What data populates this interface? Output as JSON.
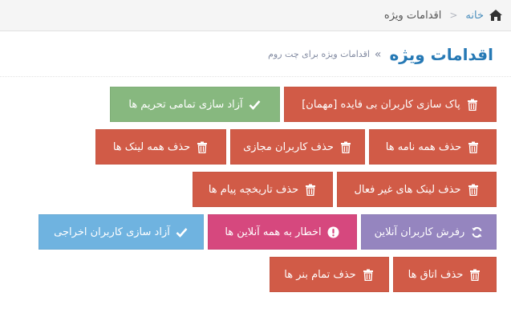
{
  "breadcrumb": {
    "home_label": "خانه",
    "separator": "<",
    "current": "اقدامات ویژه"
  },
  "header": {
    "title": "اقدامات ویژه",
    "arrow": "»",
    "subtitle": "اقدامات ویژه برای چت روم"
  },
  "colors": {
    "red": "#d15b47",
    "green": "#87b87f",
    "purple": "#9585bf",
    "pink": "#d6487e",
    "blue": "#6fb3e0",
    "title": "#2679b5"
  },
  "actions": {
    "clean_guest_users": {
      "label": "پاک سازی کاربران بی فایده [مهمان]",
      "icon": "trash-icon"
    },
    "unban_all": {
      "label": "آزاد سازی تمامی تحریم ها",
      "icon": "check-icon"
    },
    "delete_all_letters": {
      "label": "حذف همه نامه ها",
      "icon": "trash-icon"
    },
    "delete_virtual_users": {
      "label": "حذف کاربران مجازی",
      "icon": "trash-icon"
    },
    "delete_all_links": {
      "label": "حذف همه لینک ها",
      "icon": "trash-icon"
    },
    "delete_inactive_links": {
      "label": "حذف لینک های غیر فعال",
      "icon": "trash-icon"
    },
    "delete_message_history": {
      "label": "حذف تاریخچه پیام ها",
      "icon": "trash-icon"
    },
    "refresh_online_users": {
      "label": "رفرش کاربران آنلاین",
      "icon": "refresh-icon"
    },
    "alert_all_online": {
      "label": "اخطار به همه آنلاین ها",
      "icon": "exclamation-circle-icon"
    },
    "release_kicked_users": {
      "label": "آزاد سازی کاربران اخراجی",
      "icon": "check-icon"
    },
    "delete_rooms": {
      "label": "حذف اتاق ها",
      "icon": "trash-icon"
    },
    "delete_all_banners": {
      "label": "حذف تمام بنر ها",
      "icon": "trash-icon"
    }
  }
}
